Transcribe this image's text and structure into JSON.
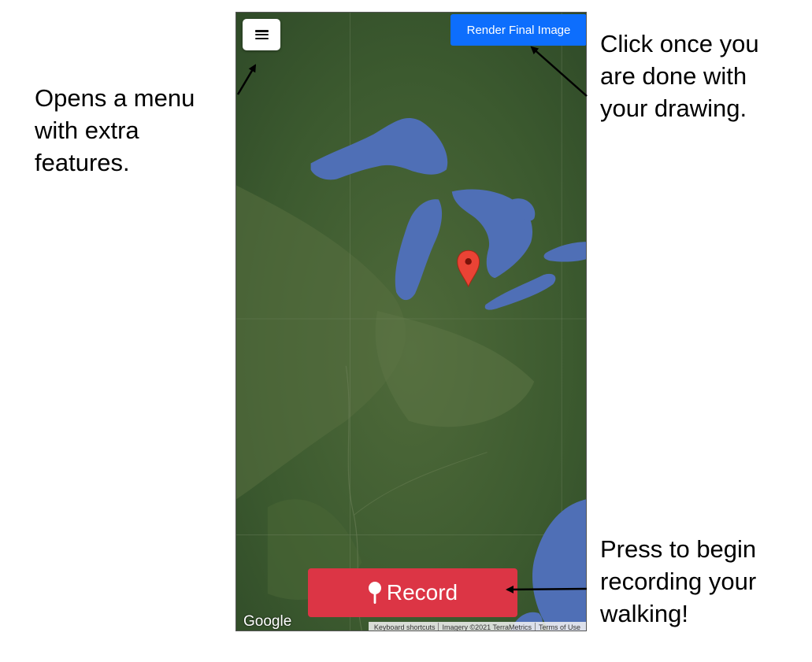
{
  "annotations": {
    "menu": [
      "Opens a menu",
      "with extra",
      "features."
    ],
    "render": [
      "Click once you",
      "are done with",
      "your drawing."
    ],
    "record": [
      "Press to begin",
      "recording your",
      "walking!"
    ]
  },
  "toolbar": {
    "menu_icon": "hamburger-menu-icon",
    "render_label": "Render Final Image"
  },
  "record_button": {
    "label": "Record",
    "icon": "map-pin-icon"
  },
  "map": {
    "provider_logo": "Google",
    "attribution": {
      "shortcuts": "Keyboard shortcuts",
      "imagery": "Imagery ©2021 TerraMetrics",
      "terms": "Terms of Use"
    },
    "marker_icon": "map-marker-icon"
  },
  "colors": {
    "render_button": "#0d6efd",
    "record_button": "#dc3545",
    "water": "#4f6fb6",
    "marker": "#ea4335"
  }
}
